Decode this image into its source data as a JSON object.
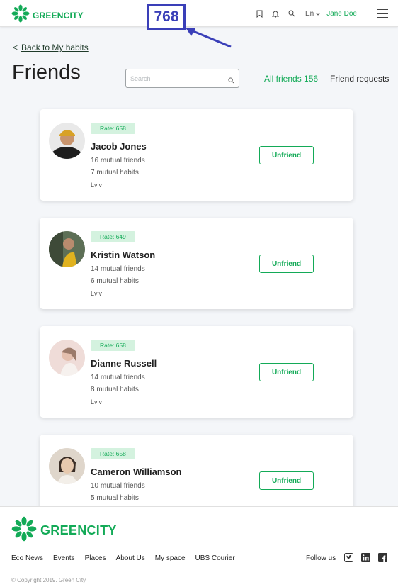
{
  "header": {
    "logo_text": "GREENCITY",
    "language": "En",
    "user_name": "Jane Doe"
  },
  "annotation": {
    "label": "768"
  },
  "nav": {
    "back_label": "Back to My habits"
  },
  "page": {
    "title": "Friends",
    "search_placeholder": "Search",
    "tab_all": "All friends 156",
    "tab_requests": "Friend requests"
  },
  "friends": [
    {
      "rate": "Rate: 658",
      "name": "Jacob Jones",
      "mutual_friends": "16 mutual friends",
      "mutual_habits": "7 mutual habits",
      "city": "Lviv",
      "button": "Unfriend",
      "avatar_color": "#2b2b2b"
    },
    {
      "rate": "Rate: 649",
      "name": "Kristin Watson",
      "mutual_friends": "14 mutual friends",
      "mutual_habits": "6 mutual habits",
      "city": "Lviv",
      "button": "Unfriend",
      "avatar_color": "#6b5a3a"
    },
    {
      "rate": "Rate: 658",
      "name": "Dianne Russell",
      "mutual_friends": "14 mutual friends",
      "mutual_habits": "8 mutual habits",
      "city": "Lviv",
      "button": "Unfriend",
      "avatar_color": "#d9b3ae"
    },
    {
      "rate": "Rate: 658",
      "name": "Cameron Williamson",
      "mutual_friends": "10 mutual friends",
      "mutual_habits": "5 mutual habits",
      "city": "",
      "button": "Unfriend",
      "avatar_color": "#c7b7a6"
    }
  ],
  "footer": {
    "logo_text": "GREENCITY",
    "links": [
      "Eco News",
      "Events",
      "Places",
      "About Us",
      "My space",
      "UBS Courier"
    ],
    "follow_label": "Follow us",
    "copyright": "© Copyright 2019. Green City."
  },
  "colors": {
    "accent": "#13aa57",
    "annotation": "#3a3fb8",
    "rate_bg": "#d4f2df"
  }
}
